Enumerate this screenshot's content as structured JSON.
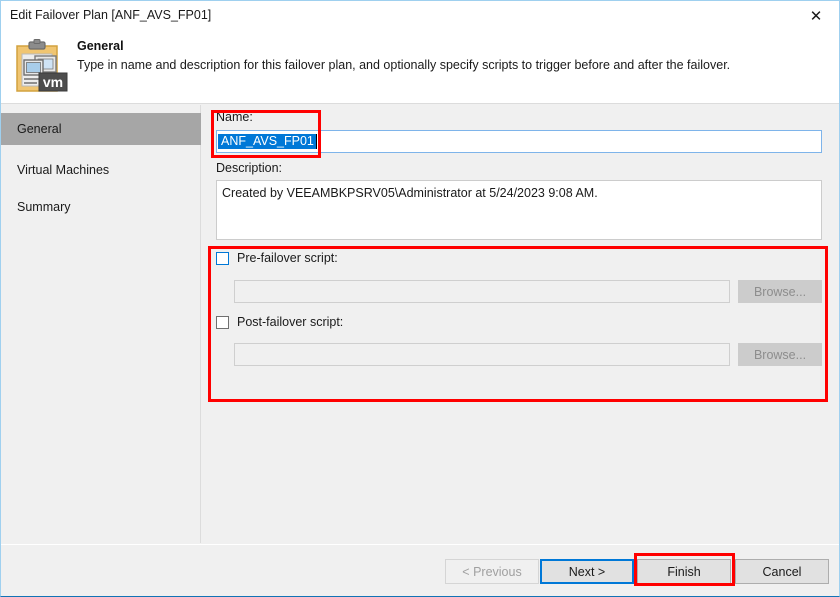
{
  "window": {
    "title": "Edit Failover Plan [ANF_AVS_FP01]",
    "close_icon": "✕"
  },
  "header": {
    "title": "General",
    "description": "Type in name and description for this failover plan, and optionally specify scripts to trigger before and after the failover."
  },
  "sidebar": {
    "items": [
      {
        "label": "General"
      },
      {
        "label": "Virtual Machines"
      },
      {
        "label": "Summary"
      }
    ]
  },
  "main": {
    "name_label": "Name:",
    "name_value": "ANF_AVS_FP01",
    "description_label": "Description:",
    "description_value": "Created by VEEAMBKPSRV05\\Administrator at 5/24/2023 9:08 AM.",
    "pre_script_label": "Pre-failover script:",
    "pre_script_value": "",
    "pre_browse_label": "Browse...",
    "post_script_label": "Post-failover script:",
    "post_script_value": "",
    "post_browse_label": "Browse..."
  },
  "footer": {
    "previous_label": "< Previous",
    "next_label": "Next >",
    "finish_label": "Finish",
    "cancel_label": "Cancel"
  },
  "colors": {
    "accent": "#0078d7",
    "annotation": "#ff0000",
    "selection": "#0078d7",
    "nav_selected": "#a6a6a6"
  }
}
